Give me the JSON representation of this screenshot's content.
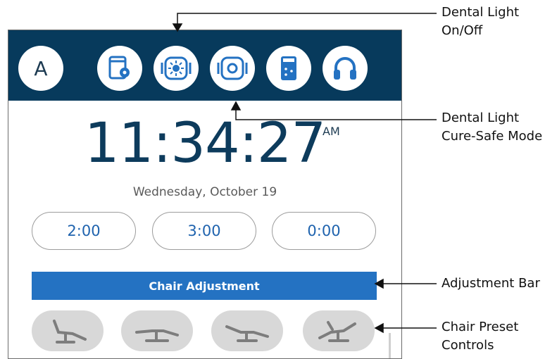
{
  "topbar": {
    "avatar_label": "A",
    "icons": [
      "tablet-settings-icon",
      "light-on-off-icon",
      "cure-safe-icon",
      "remote-icon",
      "headphones-icon"
    ]
  },
  "clock": {
    "time": "11:34:27",
    "ampm": "AM",
    "date": "Wednesday, October 19"
  },
  "timers": [
    "2:00",
    "3:00",
    "0:00"
  ],
  "adjustment_bar": {
    "label": "Chair Adjustment"
  },
  "presets": [
    "upright-chair-icon",
    "flat-chair-icon",
    "reclined-chair-icon",
    "trendelenburg-chair-icon"
  ],
  "callouts": {
    "light_on_off": [
      "Dental Light",
      "On/Off"
    ],
    "cure_safe": [
      "Dental Light",
      "Cure-Safe Mode"
    ],
    "adjustment_bar": [
      "Adjustment Bar"
    ],
    "chair_preset": [
      "Chair Preset",
      "Controls"
    ]
  },
  "colors": {
    "topbar": "#073a5c",
    "accent": "#2472c2",
    "timer_text": "#1f63ae",
    "preset_bg": "#d8d8d8"
  }
}
